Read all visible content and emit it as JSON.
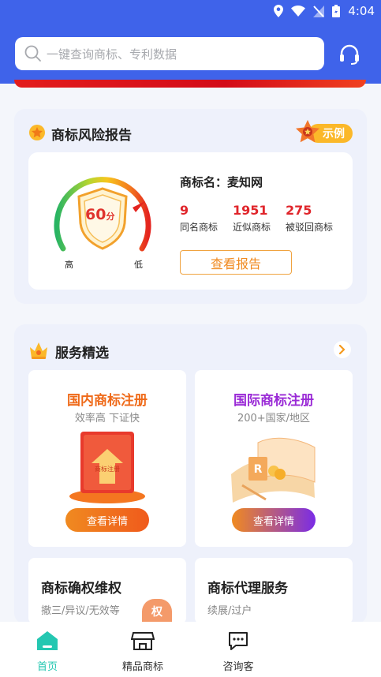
{
  "status_bar": {
    "time": "4:04"
  },
  "search": {
    "placeholder": "一键查询商标、专利数据"
  },
  "risk_report": {
    "title": "商标风险报告",
    "example_label": "示例",
    "score": "60",
    "score_unit": "分",
    "gauge_high": "高",
    "gauge_low": "低",
    "trademark_name": "商标名：麦知网",
    "stats": [
      {
        "value": "9",
        "label": "同名商标"
      },
      {
        "value": "1951",
        "label": "近似商标"
      },
      {
        "value": "275",
        "label": "被驳回商标"
      }
    ],
    "button": "查看报告"
  },
  "services": {
    "title": "服务精选",
    "tiles": [
      {
        "title": "国内商标注册",
        "subtitle": "效率高 下证快",
        "button": "查看详情",
        "art_text": "商标注册"
      },
      {
        "title": "国际商标注册",
        "subtitle": "200+国家/地区",
        "button": "查看详情",
        "art_text": "R"
      }
    ],
    "small_tiles": [
      {
        "title": "商标确权维权",
        "subtitle": "撤三/异议/无效等",
        "badge": "权"
      },
      {
        "title": "商标代理服务",
        "subtitle": "续展/过户"
      }
    ]
  },
  "nav": {
    "items": [
      {
        "label": "首页"
      },
      {
        "label": "精品商标"
      },
      {
        "label": "咨询客"
      }
    ]
  },
  "colors": {
    "brand": "#3f63ea",
    "accent_orange": "#f08a20",
    "active": "#24c7b1"
  }
}
